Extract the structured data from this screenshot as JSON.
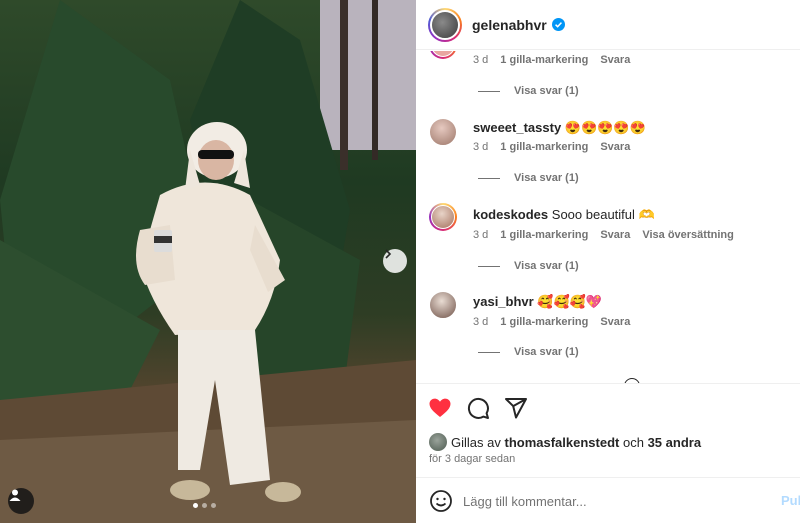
{
  "post": {
    "username": "gelenabhvr",
    "verified": true
  },
  "comments": [
    {
      "username": "",
      "text": "",
      "time": "3 d",
      "likes": "1 gilla-markering",
      "reply": "Svara",
      "translate": "",
      "view_replies": "Visa svar (1)"
    },
    {
      "username": "sweeet_tassty",
      "text": "😍😍😍😍😍",
      "time": "3 d",
      "likes": "1 gilla-markering",
      "reply": "Svara",
      "translate": "",
      "view_replies": "Visa svar (1)"
    },
    {
      "username": "kodeskodes",
      "text": "Sooo beautiful 🫶",
      "time": "3 d",
      "likes": "1 gilla-markering",
      "reply": "Svara",
      "translate": "Visa översättning",
      "view_replies": "Visa svar (1)"
    },
    {
      "username": "yasi_bhvr",
      "text": "🥰🥰🥰💖",
      "time": "3 d",
      "likes": "1 gilla-markering",
      "reply": "Svara",
      "translate": "",
      "view_replies": "Visa svar (1)"
    }
  ],
  "likes": {
    "prefix": "Gillas av",
    "user": "thomasfalkenstedt",
    "joiner": "och",
    "others": "35 andra"
  },
  "date": "för 3 dagar sedan",
  "comment_box": {
    "placeholder": "Lägg till kommentar...",
    "post_label": "Publicera"
  },
  "carousel": {
    "slides": 3,
    "active": 1
  },
  "colors": {
    "like_red": "#ff3040",
    "verified_blue": "#0095f6",
    "post_disabled": "#b3dbff"
  }
}
